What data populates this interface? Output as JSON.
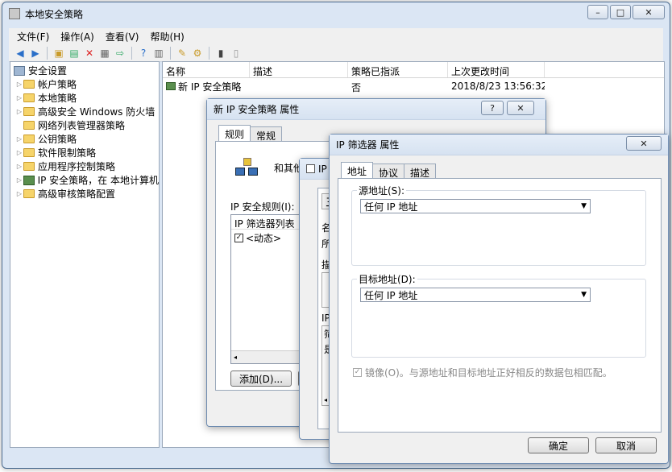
{
  "main_window": {
    "title": "本地安全策略",
    "menu": [
      "文件(F)",
      "操作(A)",
      "查看(V)",
      "帮助(H)"
    ],
    "tree": [
      {
        "label": "安全设置",
        "type": "root"
      },
      {
        "label": "帐户策略"
      },
      {
        "label": "本地策略"
      },
      {
        "label": "高级安全 Windows 防火墙"
      },
      {
        "label": "网络列表管理器策略"
      },
      {
        "label": "公钥策略"
      },
      {
        "label": "软件限制策略"
      },
      {
        "label": "应用程序控制策略"
      },
      {
        "label": "IP 安全策略，在 本地计算机"
      },
      {
        "label": "高级审核策略配置"
      }
    ],
    "columns": [
      "名称",
      "描述",
      "策略已指派",
      "上次更改时间"
    ],
    "rows": [
      {
        "name": "新 IP 安全策略",
        "desc": "",
        "assigned": "否",
        "modified": "2018/8/23 13:56:32"
      }
    ]
  },
  "policy_dialog": {
    "title": "新 IP 安全策略 属性",
    "tabs": [
      "规则",
      "常规"
    ],
    "intro_text": "和其他",
    "rules_label": "IP 安全规则(I):",
    "list_header": "IP 筛选器列表",
    "list_item": "<动态>",
    "add_button": "添加(D)..."
  },
  "middle_dialog": {
    "title_fragment": "IP",
    "text_fragments": [
      "名",
      "所",
      "描",
      "IP",
      "筛",
      "是"
    ]
  },
  "filter_dialog": {
    "title": "IP 筛选器 属性",
    "tabs": [
      "地址",
      "协议",
      "描述"
    ],
    "source_label": "源地址(S):",
    "source_value": "任何 IP 地址",
    "dest_label": "目标地址(D):",
    "dest_value": "任何 IP 地址",
    "mirror_label": "镜像(O)。与源地址和目标地址正好相反的数据包相匹配。",
    "mirror_checked": true,
    "ok_button": "确定",
    "cancel_button": "取消"
  }
}
